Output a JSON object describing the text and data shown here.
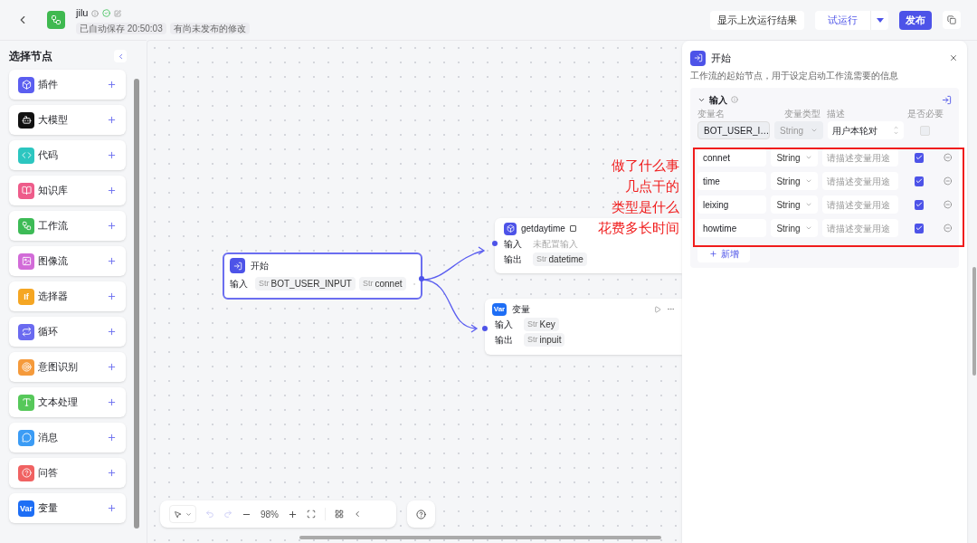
{
  "header": {
    "app_name": "jilu",
    "save_status": "已自动保存 20:50:03",
    "unpublished": "有尚未发布的修改",
    "show_last_button": "显示上次运行结果",
    "test_run_button": "试运行",
    "publish_button": "发布"
  },
  "sidebar": {
    "title": "选择节点",
    "items": [
      {
        "label": "插件",
        "color": "#5b5ef0"
      },
      {
        "label": "大模型",
        "color": "#111111"
      },
      {
        "label": "代码",
        "color": "#2cc6c0"
      },
      {
        "label": "知识库",
        "color": "#ee5c8a"
      },
      {
        "label": "工作流",
        "color": "#3dbb56"
      },
      {
        "label": "图像流",
        "color": "#d26bd8"
      },
      {
        "label": "选择器",
        "color": "#f5a623",
        "icon_text": "If"
      },
      {
        "label": "循环",
        "color": "#6a6af0"
      },
      {
        "label": "意图识别",
        "color": "#f59a3b"
      },
      {
        "label": "文本处理",
        "color": "#56c85a"
      },
      {
        "label": "消息",
        "color": "#3b9cf5"
      },
      {
        "label": "问答",
        "color": "#f06262"
      },
      {
        "label": "变量",
        "color": "#1e6ef5",
        "icon_text": "Var"
      }
    ]
  },
  "nodes": {
    "start": {
      "title": "开始",
      "input_label": "输入",
      "input_tags": [
        {
          "type": "Str",
          "name": "BOT_USER_INPUT"
        },
        {
          "type": "Str",
          "name": "connet"
        }
      ]
    },
    "plugin": {
      "title": "getdaytime",
      "input_label": "输入",
      "input_value": "未配置输入",
      "output_label": "输出",
      "output_tags": [
        {
          "type": "Str",
          "name": "datetime"
        }
      ]
    },
    "variable": {
      "title": "变量",
      "icon_text": "Var",
      "input_label": "输入",
      "input_tags": [
        {
          "type": "Str",
          "name": "Key"
        }
      ],
      "output_label": "输出",
      "output_tags": [
        {
          "type": "Str",
          "name": "inpuit"
        }
      ]
    }
  },
  "panel": {
    "title": "开始",
    "description": "工作流的起始节点，用于设定启动工作流需要的信息",
    "section_title": "输入",
    "columns": [
      "变量名",
      "变量类型",
      "描述",
      "是否必要"
    ],
    "rows": [
      {
        "name": "BOT_USER_I…",
        "type": "String",
        "description": "用户本轮对",
        "required": false,
        "disabled": true
      },
      {
        "name": "connet",
        "type": "String",
        "placeholder": "请描述变量用途",
        "required": true,
        "disabled": false
      },
      {
        "name": "time",
        "type": "String",
        "placeholder": "请描述变量用途",
        "required": true,
        "disabled": false
      },
      {
        "name": "leixing",
        "type": "String",
        "placeholder": "请描述变量用途",
        "required": true,
        "disabled": false
      },
      {
        "name": "howtime",
        "type": "String",
        "placeholder": "请描述变量用途",
        "required": true,
        "disabled": false
      }
    ],
    "add_button": "新增"
  },
  "annotations": [
    "做了什么事",
    "几点干的",
    "类型是什么",
    "花费多长时间"
  ],
  "toolbar": {
    "zoom": "98%"
  }
}
